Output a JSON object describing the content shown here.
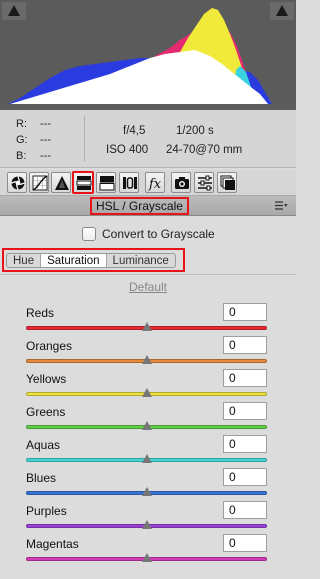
{
  "histogram": {
    "background": "#5b5b5b"
  },
  "info": {
    "rgb": [
      {
        "label": "R:",
        "value": "---"
      },
      {
        "label": "G:",
        "value": "---"
      },
      {
        "label": "B:",
        "value": "---"
      }
    ],
    "aperture": "f/4,5",
    "shutter": "1/200 s",
    "iso": "ISO 400",
    "lens": "24-70@70 mm"
  },
  "toolbar": {
    "tools": [
      {
        "name": "basic",
        "icon": "aperture-icon"
      },
      {
        "name": "tone-curve",
        "icon": "curve-icon"
      },
      {
        "name": "detail",
        "icon": "triangle-icon"
      },
      {
        "name": "hsl-grayscale",
        "icon": "hsl-icon",
        "active": true
      },
      {
        "name": "split-toning",
        "icon": "split-tone-icon"
      },
      {
        "name": "lens-corrections",
        "icon": "lens-icon"
      },
      {
        "name": "effects",
        "icon": "fx-icon"
      },
      {
        "name": "camera-calibration",
        "icon": "camera-icon"
      },
      {
        "name": "presets",
        "icon": "sliders-icon"
      },
      {
        "name": "snapshots",
        "icon": "snapshots-icon"
      }
    ]
  },
  "panel": {
    "title": "HSL / Grayscale",
    "menu_icon": "panel-menu-icon"
  },
  "convert": {
    "label": "Convert to Grayscale",
    "checked": false
  },
  "tabs": [
    {
      "label": "Hue",
      "active": false
    },
    {
      "label": "Saturation",
      "active": true
    },
    {
      "label": "Luminance",
      "active": false
    }
  ],
  "default_label": "Default",
  "sliders": [
    {
      "label": "Reds",
      "value": "0",
      "level": 0.5,
      "track": "#e82a36"
    },
    {
      "label": "Oranges",
      "value": "0",
      "level": 0.5,
      "track": "#e58a3a"
    },
    {
      "label": "Yellows",
      "value": "0",
      "level": 0.5,
      "track": "#ede23f"
    },
    {
      "label": "Greens",
      "value": "0",
      "level": 0.5,
      "track": "#62cf4a"
    },
    {
      "label": "Aquas",
      "value": "0",
      "level": 0.5,
      "track": "#44d6d4"
    },
    {
      "label": "Blues",
      "value": "0",
      "level": 0.5,
      "track": "#3a74d6"
    },
    {
      "label": "Purples",
      "value": "0",
      "level": 0.5,
      "track": "#9a42d8"
    },
    {
      "label": "Magentas",
      "value": "0",
      "level": 0.5,
      "track": "#d33ab6"
    }
  ]
}
